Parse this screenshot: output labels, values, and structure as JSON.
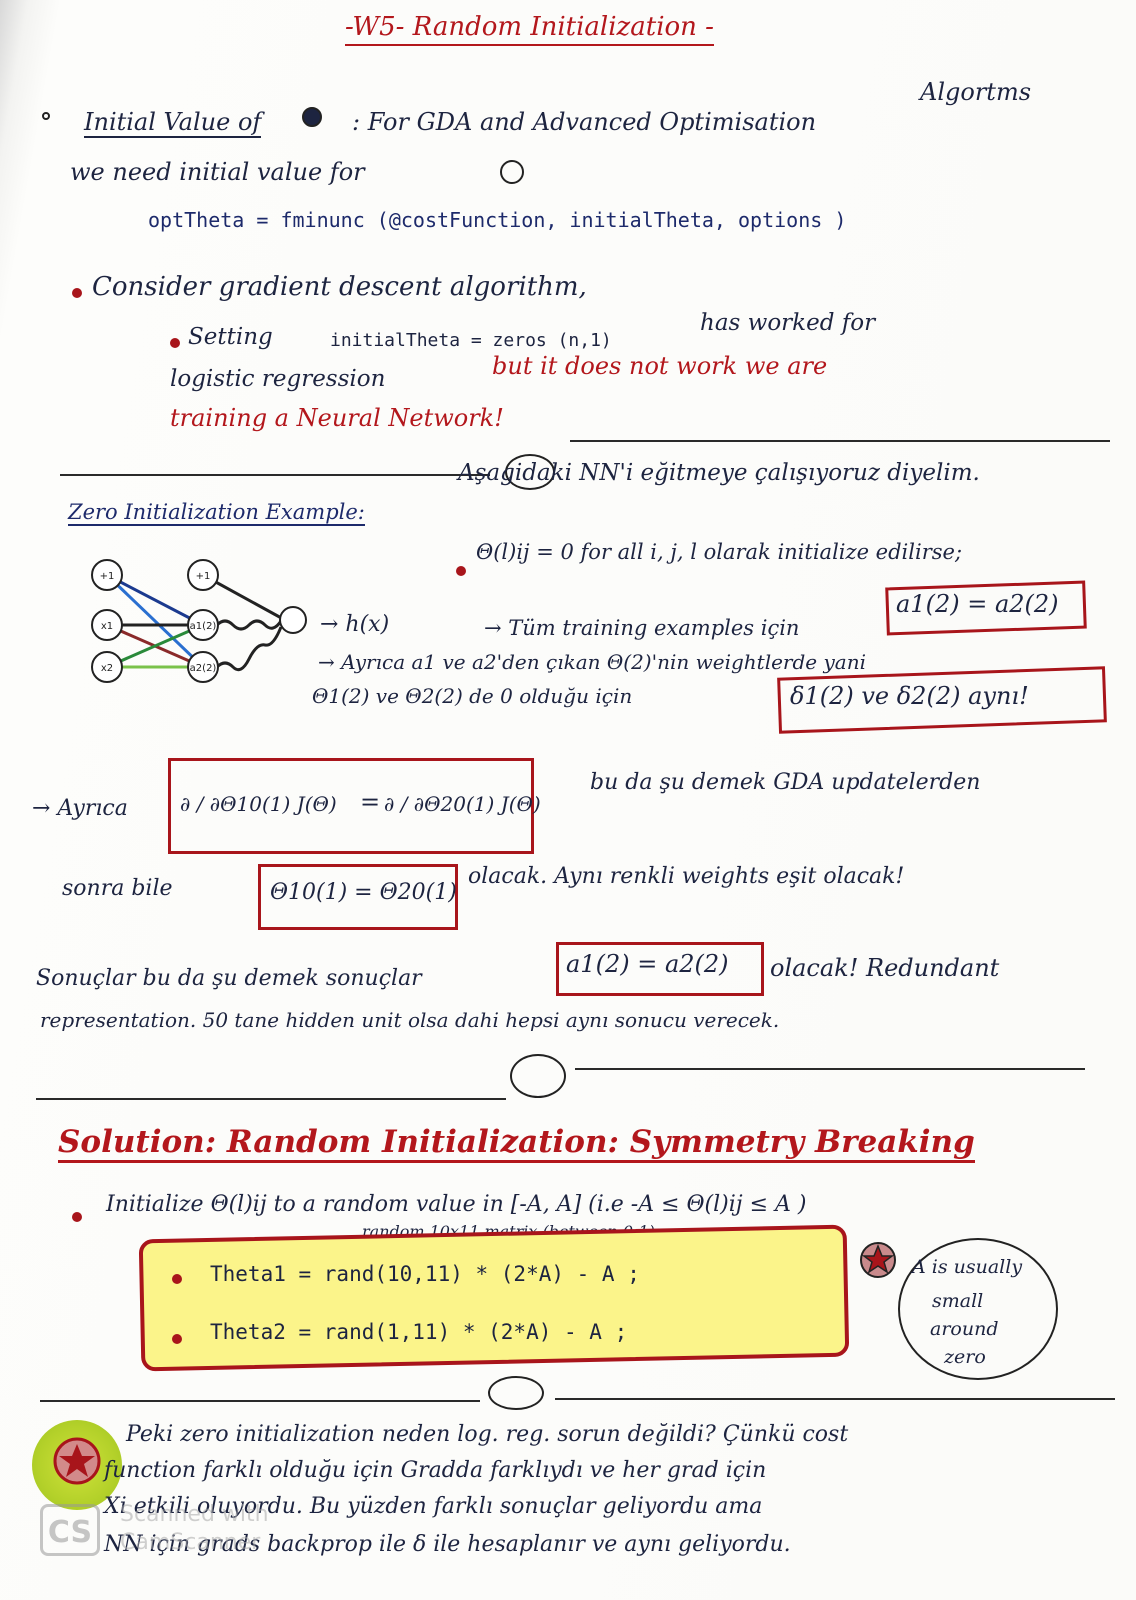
{
  "title": "-W5- Random Initialization -",
  "s1": {
    "l1a": "Initial Value of",
    "l1b": ": For GDA and Advanced Optimisation",
    "l1c": "Algortms",
    "l2": "we need initial value for",
    "code": "optTheta = fminunc (@costFunction, initialTheta, options )",
    "consider": "Consider gradient descent algorithm,",
    "b1a": "Setting",
    "b1b": "initialTheta = zeros (n,1)",
    "b1c": "has worked for",
    "b1d": "logistic regression",
    "b1e": "but it does not work we are",
    "b1f": "training a Neural Network!"
  },
  "s2": {
    "headA": "Zero Initialization Example:",
    "headB": "Aşagidaki NN'i eğitmeye çalışıyoruz diyelim.",
    "line1": "Θ(l)ij = 0  for all i, j, l  olarak initialize edilirse;",
    "line2": "→ Tüm training examples için",
    "box2": "a1(2) = a2(2)",
    "line3": "→ Ayrıca a1 ve a2'den çıkan Θ(2)'nin weightlerde yani",
    "line4": "Θ1(2) ve Θ2(2) de 0 olduğu için",
    "box3": "δ1(2) ve δ2(2) aynı!",
    "hx": "→ h(x)",
    "nodes": {
      "b1": "+1",
      "b2": "+1",
      "x1": "x1",
      "x2": "x2",
      "a1": "a1(2)",
      "a2": "a2(2)"
    },
    "ayrica": "→ Ayrıca",
    "frac1": "∂ / ∂Θ10(1)  J(Θ)",
    "frac2": "∂ / ∂Θ20(1)  J(Θ)",
    "bu": "bu da şu demek GDA updatelerden",
    "sonra": "sonra bile",
    "box5": "Θ10(1) = Θ20(1)",
    "olacak": "olacak. Aynı renkli weights eşit olacak!",
    "sonuclar": "Sonuçlar bu da şu demek sonuçlar",
    "box6": "a1(2) = a2(2)",
    "redundant": "olacak! Redundant",
    "rep": "representation. 50 tane hidden unit olsa dahi hepsi aynı sonucu verecek."
  },
  "s3": {
    "head": "Solution: Random Initialization: Symmetry Breaking",
    "init": "Initialize Θ(l)ij to a random value in [-A, A]  (i.e -A ≤ Θ(l)ij ≤ A )",
    "note": "random 10x11 matrix (between 0-1)",
    "t1": "Theta1 = rand(10,11) * (2*A) - A ;",
    "t2": "Theta2 = rand(1,11) * (2*A) - A ;",
    "bubble": [
      "A is usually",
      "small",
      "around",
      "zero"
    ]
  },
  "s4": {
    "l1": "Peki zero initialization neden log. reg. sorun değildi? Çünkü cost",
    "l2": "function farklı olduğu için Gradda farklıydı ve her grad için",
    "l3": "Xi etkili oluyordu. Bu yüzden farklı sonuçlar geliyordu ama",
    "l4": "NN için grads backprop ile δ ile hesaplanır ve aynı geliyordu."
  },
  "watermark": {
    "logo": "CS",
    "line1": "Scanned with",
    "line2": "CamScanner"
  }
}
